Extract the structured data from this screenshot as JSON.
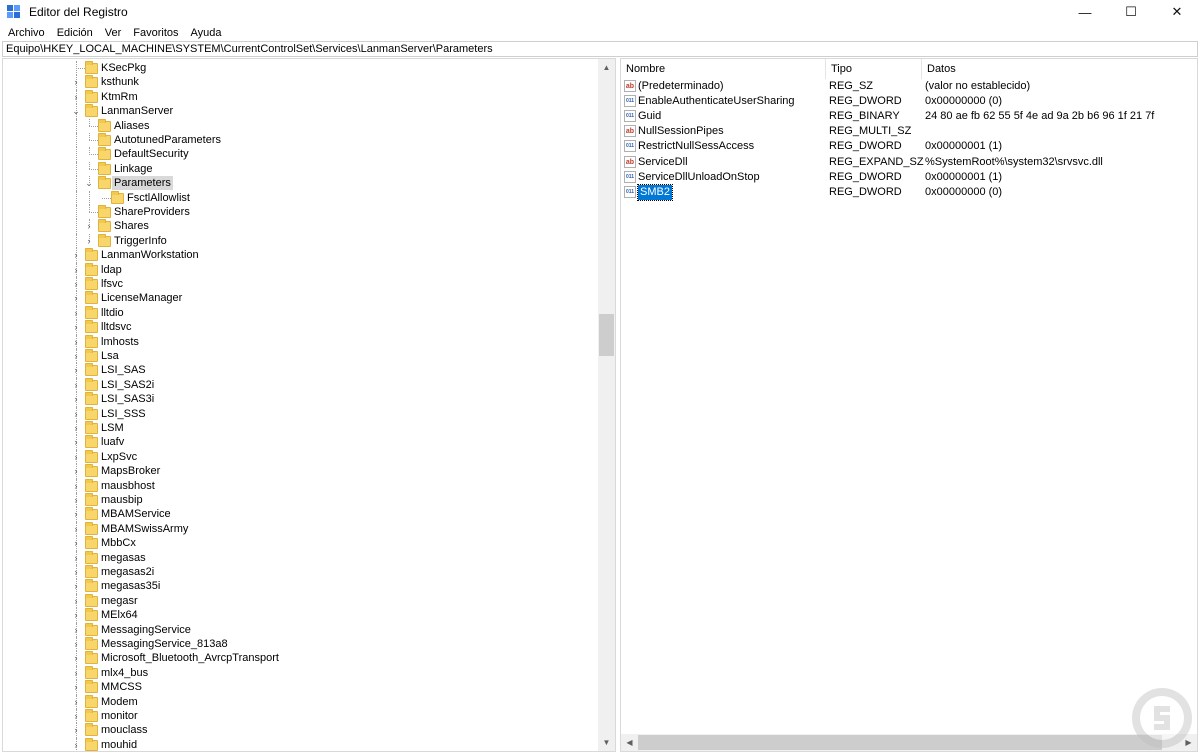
{
  "window": {
    "title": "Editor del Registro",
    "controls": {
      "minimize": "—",
      "maximize": "☐",
      "close": "✕"
    }
  },
  "menu": [
    "Archivo",
    "Edición",
    "Ver",
    "Favoritos",
    "Ayuda"
  ],
  "address": "Equipo\\HKEY_LOCAL_MACHINE\\SYSTEM\\CurrentControlSet\\Services\\LanmanServer\\Parameters",
  "tree": [
    {
      "label": "KSecPkg",
      "level": 0,
      "exp": "none"
    },
    {
      "label": "ksthunk",
      "level": 0,
      "exp": "collapsed"
    },
    {
      "label": "KtmRm",
      "level": 0,
      "exp": "collapsed"
    },
    {
      "label": "LanmanServer",
      "level": 0,
      "exp": "expanded"
    },
    {
      "label": "Aliases",
      "level": 1,
      "exp": "none"
    },
    {
      "label": "AutotunedParameters",
      "level": 1,
      "exp": "none"
    },
    {
      "label": "DefaultSecurity",
      "level": 1,
      "exp": "none"
    },
    {
      "label": "Linkage",
      "level": 1,
      "exp": "none"
    },
    {
      "label": "Parameters",
      "level": 1,
      "exp": "expanded",
      "selected": true
    },
    {
      "label": "FsctlAllowlist",
      "level": 2,
      "exp": "none"
    },
    {
      "label": "ShareProviders",
      "level": 1,
      "exp": "none"
    },
    {
      "label": "Shares",
      "level": 1,
      "exp": "collapsed"
    },
    {
      "label": "TriggerInfo",
      "level": 1,
      "exp": "collapsed"
    },
    {
      "label": "LanmanWorkstation",
      "level": 0,
      "exp": "collapsed"
    },
    {
      "label": "ldap",
      "level": 0,
      "exp": "collapsed"
    },
    {
      "label": "lfsvc",
      "level": 0,
      "exp": "collapsed"
    },
    {
      "label": "LicenseManager",
      "level": 0,
      "exp": "collapsed"
    },
    {
      "label": "lltdio",
      "level": 0,
      "exp": "collapsed"
    },
    {
      "label": "lltdsvc",
      "level": 0,
      "exp": "collapsed"
    },
    {
      "label": "lmhosts",
      "level": 0,
      "exp": "collapsed"
    },
    {
      "label": "Lsa",
      "level": 0,
      "exp": "collapsed"
    },
    {
      "label": "LSI_SAS",
      "level": 0,
      "exp": "collapsed"
    },
    {
      "label": "LSI_SAS2i",
      "level": 0,
      "exp": "collapsed"
    },
    {
      "label": "LSI_SAS3i",
      "level": 0,
      "exp": "collapsed"
    },
    {
      "label": "LSI_SSS",
      "level": 0,
      "exp": "collapsed"
    },
    {
      "label": "LSM",
      "level": 0,
      "exp": "collapsed"
    },
    {
      "label": "luafv",
      "level": 0,
      "exp": "collapsed"
    },
    {
      "label": "LxpSvc",
      "level": 0,
      "exp": "collapsed"
    },
    {
      "label": "MapsBroker",
      "level": 0,
      "exp": "collapsed"
    },
    {
      "label": "mausbhost",
      "level": 0,
      "exp": "collapsed"
    },
    {
      "label": "mausbip",
      "level": 0,
      "exp": "collapsed"
    },
    {
      "label": "MBAMService",
      "level": 0,
      "exp": "collapsed"
    },
    {
      "label": "MBAMSwissArmy",
      "level": 0,
      "exp": "collapsed"
    },
    {
      "label": "MbbCx",
      "level": 0,
      "exp": "collapsed"
    },
    {
      "label": "megasas",
      "level": 0,
      "exp": "collapsed"
    },
    {
      "label": "megasas2i",
      "level": 0,
      "exp": "collapsed"
    },
    {
      "label": "megasas35i",
      "level": 0,
      "exp": "collapsed"
    },
    {
      "label": "megasr",
      "level": 0,
      "exp": "collapsed"
    },
    {
      "label": "MElx64",
      "level": 0,
      "exp": "collapsed"
    },
    {
      "label": "MessagingService",
      "level": 0,
      "exp": "collapsed"
    },
    {
      "label": "MessagingService_813a8",
      "level": 0,
      "exp": "collapsed"
    },
    {
      "label": "Microsoft_Bluetooth_AvrcpTransport",
      "level": 0,
      "exp": "collapsed"
    },
    {
      "label": "mlx4_bus",
      "level": 0,
      "exp": "collapsed"
    },
    {
      "label": "MMCSS",
      "level": 0,
      "exp": "collapsed"
    },
    {
      "label": "Modem",
      "level": 0,
      "exp": "collapsed"
    },
    {
      "label": "monitor",
      "level": 0,
      "exp": "collapsed"
    },
    {
      "label": "mouclass",
      "level": 0,
      "exp": "collapsed"
    },
    {
      "label": "mouhid",
      "level": 0,
      "exp": "collapsed"
    }
  ],
  "columns": {
    "name": "Nombre",
    "type": "Tipo",
    "data": "Datos"
  },
  "values": [
    {
      "name": "(Predeterminado)",
      "type": "REG_SZ",
      "data": "(valor no establecido)",
      "icon": "string-value-icon"
    },
    {
      "name": "EnableAuthenticateUserSharing",
      "type": "REG_DWORD",
      "data": "0x00000000 (0)",
      "icon": "binary-value-icon"
    },
    {
      "name": "Guid",
      "type": "REG_BINARY",
      "data": "24 80 ae fb 62 55 5f 4e ad 9a 2b b6 96 1f 21 7f",
      "icon": "binary-value-icon"
    },
    {
      "name": "NullSessionPipes",
      "type": "REG_MULTI_SZ",
      "data": "",
      "icon": "string-value-icon"
    },
    {
      "name": "RestrictNullSessAccess",
      "type": "REG_DWORD",
      "data": "0x00000001 (1)",
      "icon": "binary-value-icon"
    },
    {
      "name": "ServiceDll",
      "type": "REG_EXPAND_SZ",
      "data": "%SystemRoot%\\system32\\srvsvc.dll",
      "icon": "string-value-icon"
    },
    {
      "name": "ServiceDllUnloadOnStop",
      "type": "REG_DWORD",
      "data": "0x00000001 (1)",
      "icon": "binary-value-icon"
    },
    {
      "name": "SMB2",
      "type": "REG_DWORD",
      "data": "0x00000000 (0)",
      "icon": "binary-value-icon",
      "selected": true
    }
  ],
  "icons": {
    "string_glyph": "ab",
    "binary_glyph": "011"
  },
  "scrollbar_arrows": {
    "up": "▲",
    "down": "▼",
    "left": "◀",
    "right": "▶"
  },
  "colors": {
    "selection": "#0078d7",
    "folder": "#f9d66c",
    "tree_selection": "#d9d9d9"
  }
}
